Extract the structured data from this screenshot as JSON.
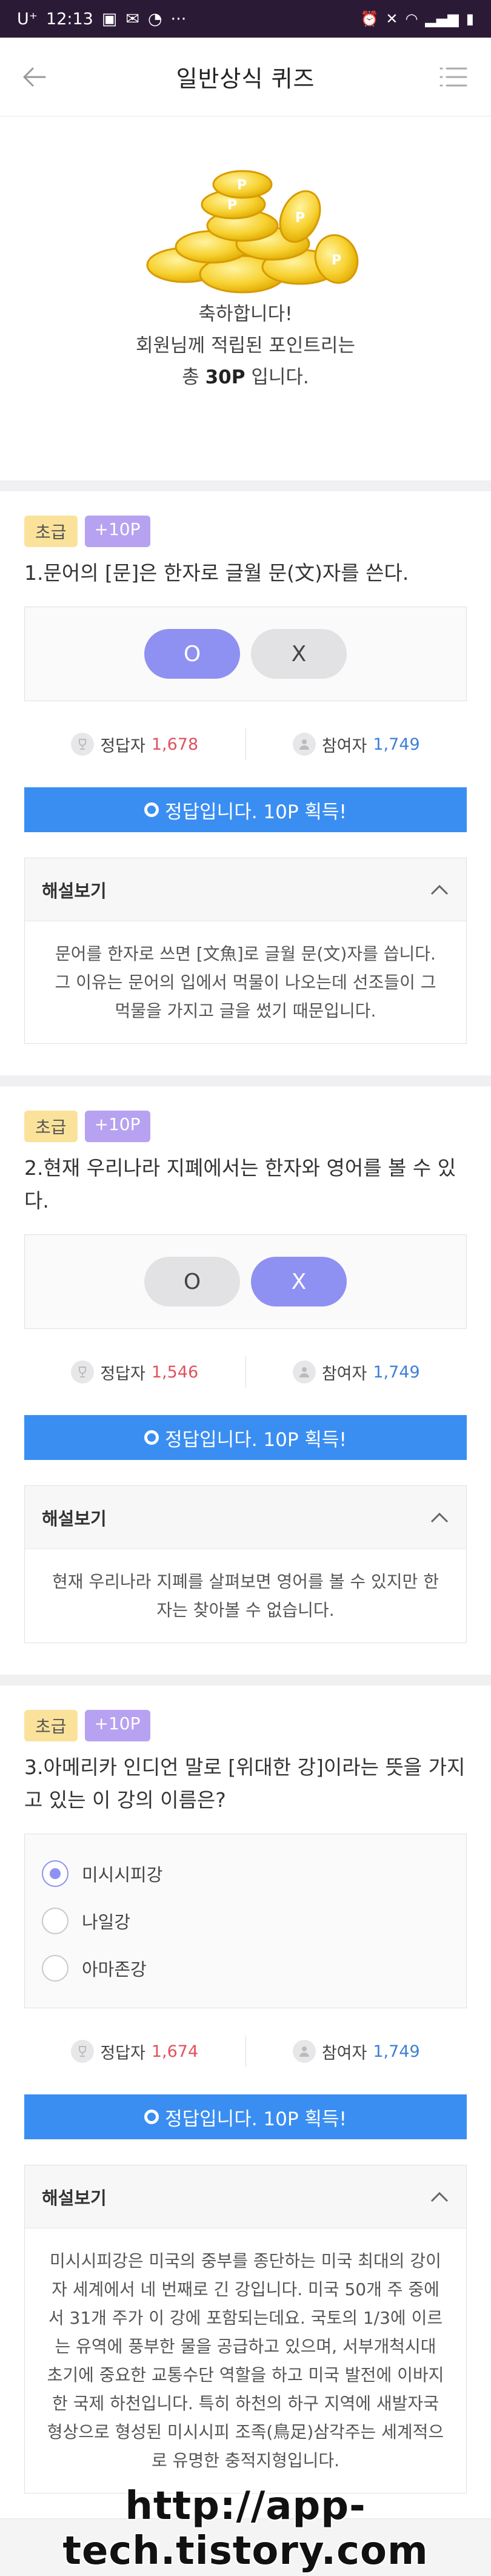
{
  "status_bar": {
    "carrier": "U⁺",
    "time": "12:13",
    "more": "···"
  },
  "app_bar": {
    "title": "일반상식 퀴즈"
  },
  "congrats": {
    "line1": "축하합니다!",
    "line2": "회원님께 적립된 포인트리는",
    "line3_prefix": "총 ",
    "points": "30P",
    "line3_suffix": " 입니다."
  },
  "quizzes": [
    {
      "level": "초급",
      "point_tag": "+10P",
      "question": "1.문어의 [문]은 한자로 글월 문(文)자를 쓴다.",
      "answers": [
        "O",
        "X"
      ],
      "selected": "O",
      "correct_label": "정답자",
      "correct_count": "1,678",
      "participants_label": "참여자",
      "participants_count": "1,749",
      "result": "정답입니다. 10P 획득!",
      "explain_title": "해설보기",
      "explain_body": "문어를 한자로 쓰면 [文魚]로 글월 문(文)자를 씁니다. 그 이유는 문어의 입에서 먹물이 나오는데 선조들이 그 먹물을 가지고 글을 썼기 때문입니다."
    },
    {
      "level": "초급",
      "point_tag": "+10P",
      "question": "2.현재 우리나라 지폐에서는 한자와 영어를 볼 수 있다.",
      "answers": [
        "O",
        "X"
      ],
      "selected": "X",
      "correct_label": "정답자",
      "correct_count": "1,546",
      "participants_label": "참여자",
      "participants_count": "1,749",
      "result": "정답입니다. 10P 획득!",
      "explain_title": "해설보기",
      "explain_body": "현재 우리나라 지폐를 살펴보면 영어를 볼 수 있지만 한자는 찾아볼 수 없습니다."
    },
    {
      "level": "초급",
      "point_tag": "+10P",
      "question": "3.아메리카 인디언 말로 [위대한 강]이라는 뜻을 가지고 있는 이 강의 이름은?",
      "options": [
        "미시시피강",
        "나일강",
        "아마존강"
      ],
      "selected": "미시시피강",
      "correct_label": "정답자",
      "correct_count": "1,674",
      "participants_label": "참여자",
      "participants_count": "1,749",
      "result": "정답입니다. 10P 획득!",
      "explain_title": "해설보기",
      "explain_body": "미시시피강은 미국의 중부를 종단하는 미국 최대의 강이자 세계에서 네 번째로 긴 강입니다. 미국 50개 주 중에서 31개 주가 이 강에 포함되는데요. 국토의 1/3에 이르는 유역에 풍부한 물을 공급하고 있으며, 서부개척시대 초기에 중요한 교통수단 역할을 하고 미국 발전에 이바지한 국제 하천입니다. 특히 하천의 하구 지역에 새발자국 형상으로 형성된 미시시피 조족(鳥足)삼각주는 세계적으로 유명한 충적지형입니다."
    }
  ],
  "watermark": "http://app-tech.tistory.com",
  "colors": {
    "accent": "#8e91f1",
    "result_blue": "#3a8ef2",
    "correct_red": "#e0525f",
    "participants_blue": "#3d7fd6",
    "status_bar": "#2b1a35"
  }
}
